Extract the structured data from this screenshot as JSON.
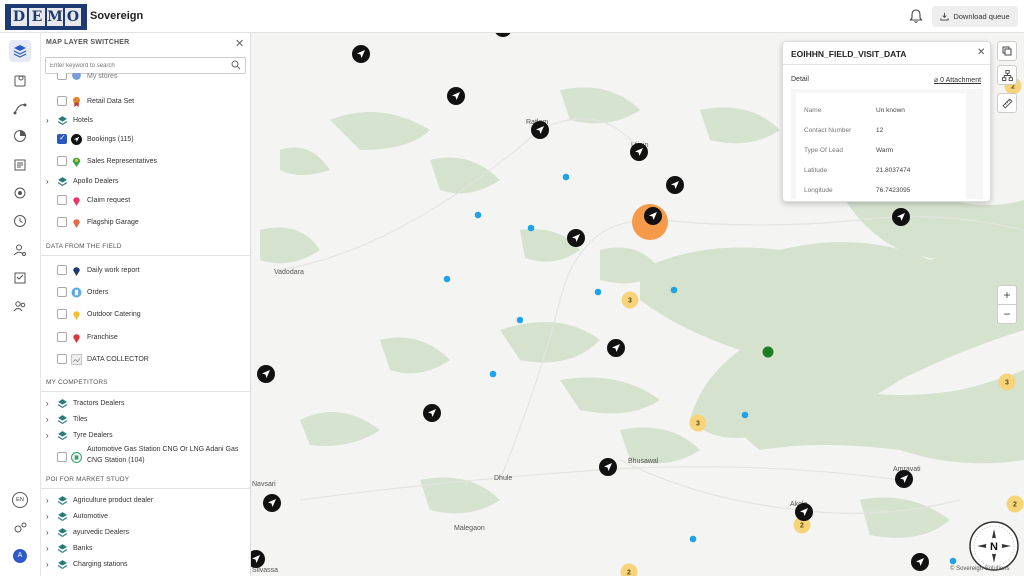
{
  "header": {
    "logo_letters": [
      "D",
      "E",
      "M",
      "O"
    ],
    "app_title": "Sovereign",
    "download_label": "Download queue"
  },
  "rail": {
    "icons": [
      "layers-icon",
      "map-pin-route-icon",
      "route-icon",
      "pie-chart-icon",
      "report-icon",
      "location-target-icon",
      "history-icon",
      "user-settings-icon",
      "checklist-icon",
      "users-icon"
    ],
    "lang": "EN",
    "avatar": "A"
  },
  "panel": {
    "title": "MAP LAYER SWITCHER",
    "search_placeholder": "Enter keyword to search",
    "top_items": [
      {
        "label": "My stores",
        "type": "item",
        "checked": false
      },
      {
        "label": "Retail Data Set",
        "type": "item",
        "checked": false
      },
      {
        "label": "Hotels",
        "type": "group"
      },
      {
        "label": "Bookings (115)",
        "type": "item",
        "checked": true
      },
      {
        "label": "Sales Representatives",
        "type": "item",
        "checked": false
      },
      {
        "label": "Apollo Dealers",
        "type": "group"
      },
      {
        "label": "Claim request",
        "type": "item",
        "checked": false
      },
      {
        "label": "Flagship Garage",
        "type": "item",
        "checked": false
      }
    ],
    "section_field": "DATA FROM THE FIELD",
    "field_items": [
      {
        "label": "Daily work report"
      },
      {
        "label": "Orders"
      },
      {
        "label": "Outdoor Catering"
      },
      {
        "label": "Franchise"
      },
      {
        "label": "DATA COLLECTOR"
      }
    ],
    "section_competitors": "MY COMPETITORS",
    "competitor_items": [
      {
        "label": "Tractors Dealers"
      },
      {
        "label": "Tiles"
      },
      {
        "label": "Tyre Dealers"
      }
    ],
    "gas_line1": "Automotive Gas Station CNG Or LNG Adani Gas",
    "gas_line2": "CNG Station (104)",
    "section_poi": "POI FOR MARKET STUDY",
    "poi_items": [
      {
        "label": "Agriculture product dealer"
      },
      {
        "label": "Automotive"
      },
      {
        "label": "ayurvedic Dealers"
      },
      {
        "label": "Banks"
      },
      {
        "label": "Charging stations"
      }
    ]
  },
  "popup": {
    "title": "EOIHHN_FIELD_VISIT_DATA",
    "detail_label": "Detail",
    "attachment": "0 Attachment",
    "rows": [
      {
        "key": "Name",
        "value": "Un known"
      },
      {
        "key": "Contact Number",
        "value": "12"
      },
      {
        "key": "Type Of Lead",
        "value": "Warm"
      },
      {
        "key": "Latitude",
        "value": "21.8037474"
      },
      {
        "key": "Longitude",
        "value": "76.7423095"
      }
    ]
  },
  "map": {
    "city_labels": [
      "Vadodara",
      "Ratlam",
      "Ujjain",
      "Bhusawal",
      "Dhule",
      "Malegaon",
      "Amravati",
      "Akola",
      "Navsari",
      "Silvassa"
    ],
    "cluster_counts": [
      "3",
      "3",
      "3",
      "2",
      "2",
      "2",
      "2"
    ],
    "zoom_in": "+",
    "zoom_out": "−",
    "compass": "N",
    "copyright": "© Sovereign Solutions",
    "colors": {
      "land": "#f4f4f2",
      "forest": "#d5e3d0",
      "marker": "#111111",
      "dot": "#1fa3e6",
      "cluster": "#f7d47a",
      "highlight": "#f59a4a",
      "green_dot": "#1e7d22"
    }
  }
}
